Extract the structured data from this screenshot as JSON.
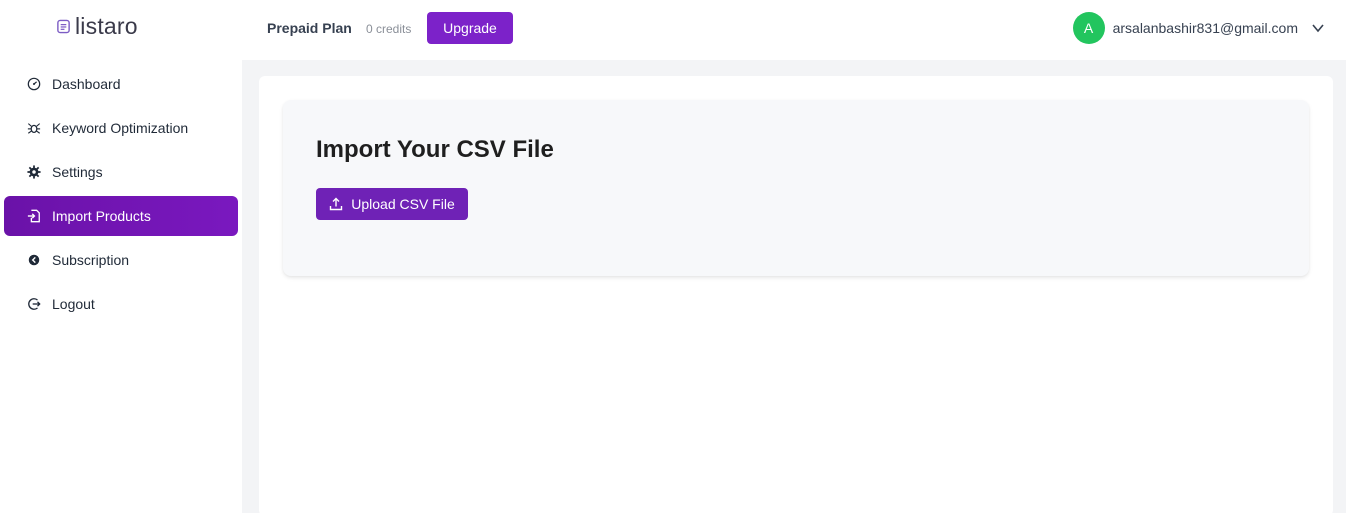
{
  "brand": {
    "name": "listaro",
    "icon": "document-icon"
  },
  "header": {
    "plan_name": "Prepaid Plan",
    "credits": "0 credits",
    "upgrade_label": "Upgrade",
    "user": {
      "avatar_initial": "A",
      "email": "arsalanbashir831@gmail.com",
      "avatar_color": "#22c55e"
    }
  },
  "sidebar": {
    "items": [
      {
        "label": "Dashboard",
        "icon": "dashboard-gauge-icon",
        "active": false
      },
      {
        "label": "Keyword Optimization",
        "icon": "bug-icon",
        "active": false
      },
      {
        "label": "Settings",
        "icon": "gear-icon",
        "active": false
      },
      {
        "label": "Import Products",
        "icon": "file-import-icon",
        "active": true
      },
      {
        "label": "Subscription",
        "icon": "subscription-icon",
        "active": false
      },
      {
        "label": "Logout",
        "icon": "logout-icon",
        "active": false
      }
    ]
  },
  "main": {
    "card_title": "Import Your CSV File",
    "upload_label": "Upload CSV File"
  },
  "colors": {
    "accent": "#7c22c9",
    "active_nav": "#6a12a8",
    "avatar": "#22c55e"
  }
}
